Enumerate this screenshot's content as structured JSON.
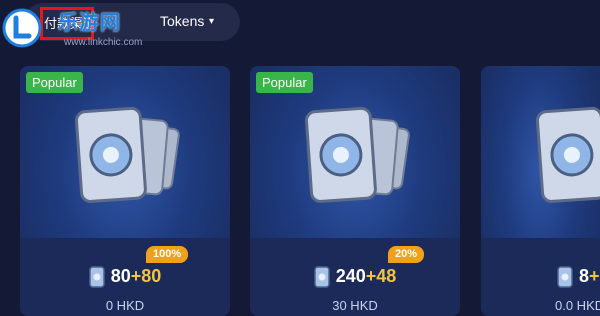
{
  "header": {
    "channel_label": "付款渠道",
    "tokens_label": "Tokens",
    "caret": "▾"
  },
  "watermark": {
    "name": "乐游网",
    "url": "www.linkchic.com"
  },
  "cards": [
    {
      "badge": "Popular",
      "bonus_pct": "100%",
      "base": "80",
      "bonus": "+80",
      "subprice": "0 HKD"
    },
    {
      "badge": "Popular",
      "bonus_pct": "20%",
      "base": "240",
      "bonus": "+48",
      "subprice": "30 HKD"
    },
    {
      "badge": "",
      "bonus_pct": "",
      "base": "8",
      "bonus": "+",
      "subprice": "0.0 HKD"
    }
  ],
  "colors": {
    "background": "#141a35",
    "popular_badge": "#39b54a",
    "bonus_tag": "#f0a01a",
    "bonus_text": "#f5c342",
    "highlight_box": "#e5161d"
  },
  "icons": {
    "ticket": "ticket-stack-icon",
    "coin": "token-coin-icon",
    "dropdown": "chevron-down-icon"
  }
}
